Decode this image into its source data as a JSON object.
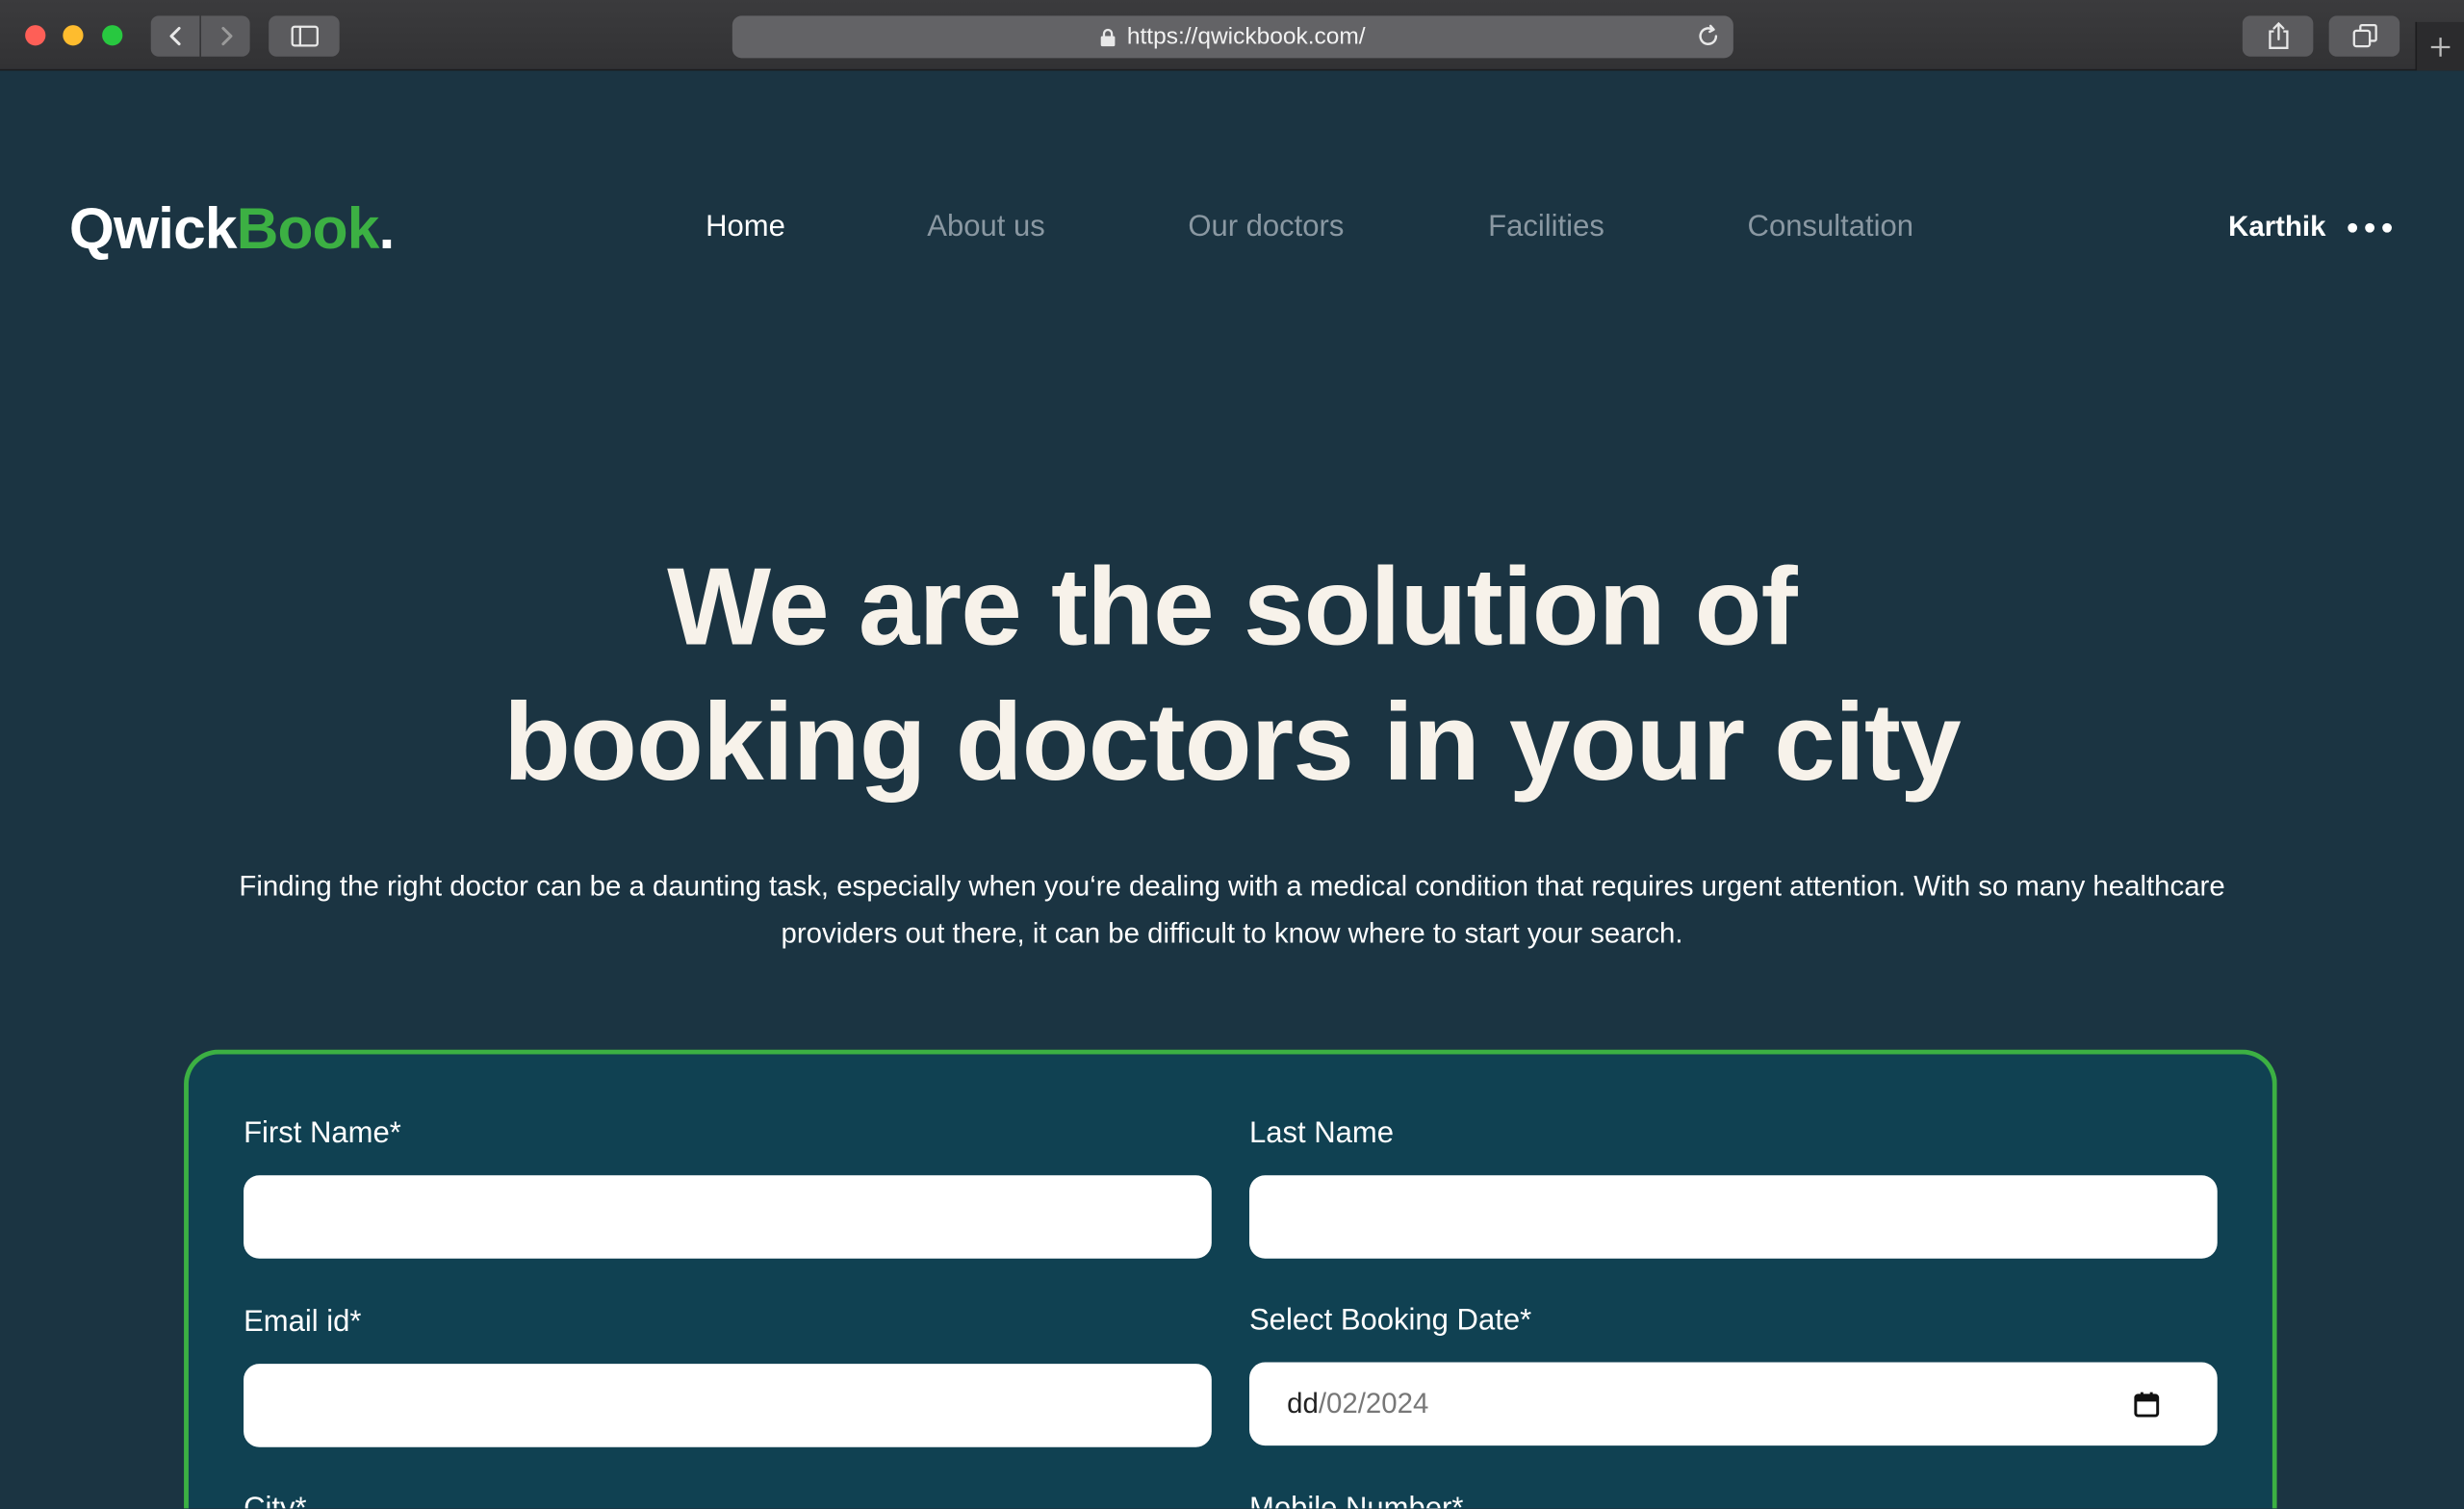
{
  "browser": {
    "url": "https://qwickbook.com/"
  },
  "header": {
    "logo": {
      "part1": "Qwick",
      "part2": "Book",
      "dot": "."
    },
    "nav": [
      {
        "label": "Home",
        "active": true
      },
      {
        "label": "About us"
      },
      {
        "label": "Our doctors"
      },
      {
        "label": "Facilities"
      },
      {
        "label": "Consultation"
      }
    ],
    "user_name": "Karthik"
  },
  "hero": {
    "title_line1": "We are the solution of",
    "title_line2": "booking doctors in your city",
    "subtitle_line1": "Finding the right doctor can be a daunting task, especially when you‘re dealing with a medical condition that requires urgent attention. With so many healthcare",
    "subtitle_line2": "providers out there, it can be difficult to know where to start your search."
  },
  "form": {
    "first_name_label": "First Name*",
    "first_name_value": "",
    "last_name_label": "Last Name",
    "last_name_value": "",
    "email_label": "Email id*",
    "email_value": "",
    "date_label": "Select Booking Date*",
    "date_day": "dd",
    "date_rest": "/02/2024",
    "city_label": "City*",
    "mobile_label": "Mobile Number*"
  },
  "colors": {
    "page_bg": "#1b3442",
    "card_bg": "#104152",
    "accent_green": "#3cb043",
    "title_color": "#f7f2ea"
  }
}
